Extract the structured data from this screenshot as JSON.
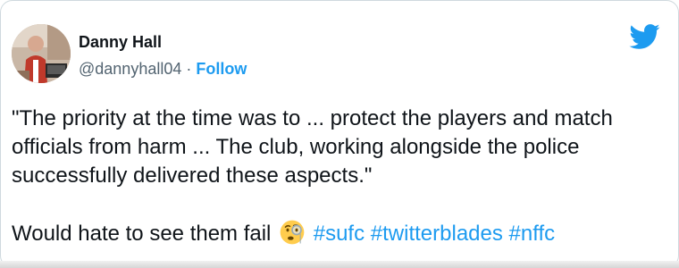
{
  "author": {
    "display_name": "Danny Hall",
    "handle": "@dannyhall04",
    "separator": "·",
    "follow_label": "Follow"
  },
  "tweet": {
    "paragraph_1": "\"The priority at the time was to ... protect the players and match officials from harm ... The club, working alongside the police successfully delivered these aspects.\"",
    "paragraph_2_text": "Would hate to see them fail",
    "emoji": "face-with-monocle",
    "hashtags": [
      "#sufc",
      "#twitterblades",
      "#nffc"
    ]
  },
  "colors": {
    "accent": "#1d9bf0",
    "text": "#0f1419",
    "secondary_text": "#536471",
    "border": "#cfd9de"
  },
  "icons": {
    "logo": "twitter-bird-icon",
    "emoji_icon": "monocle-face-icon"
  }
}
